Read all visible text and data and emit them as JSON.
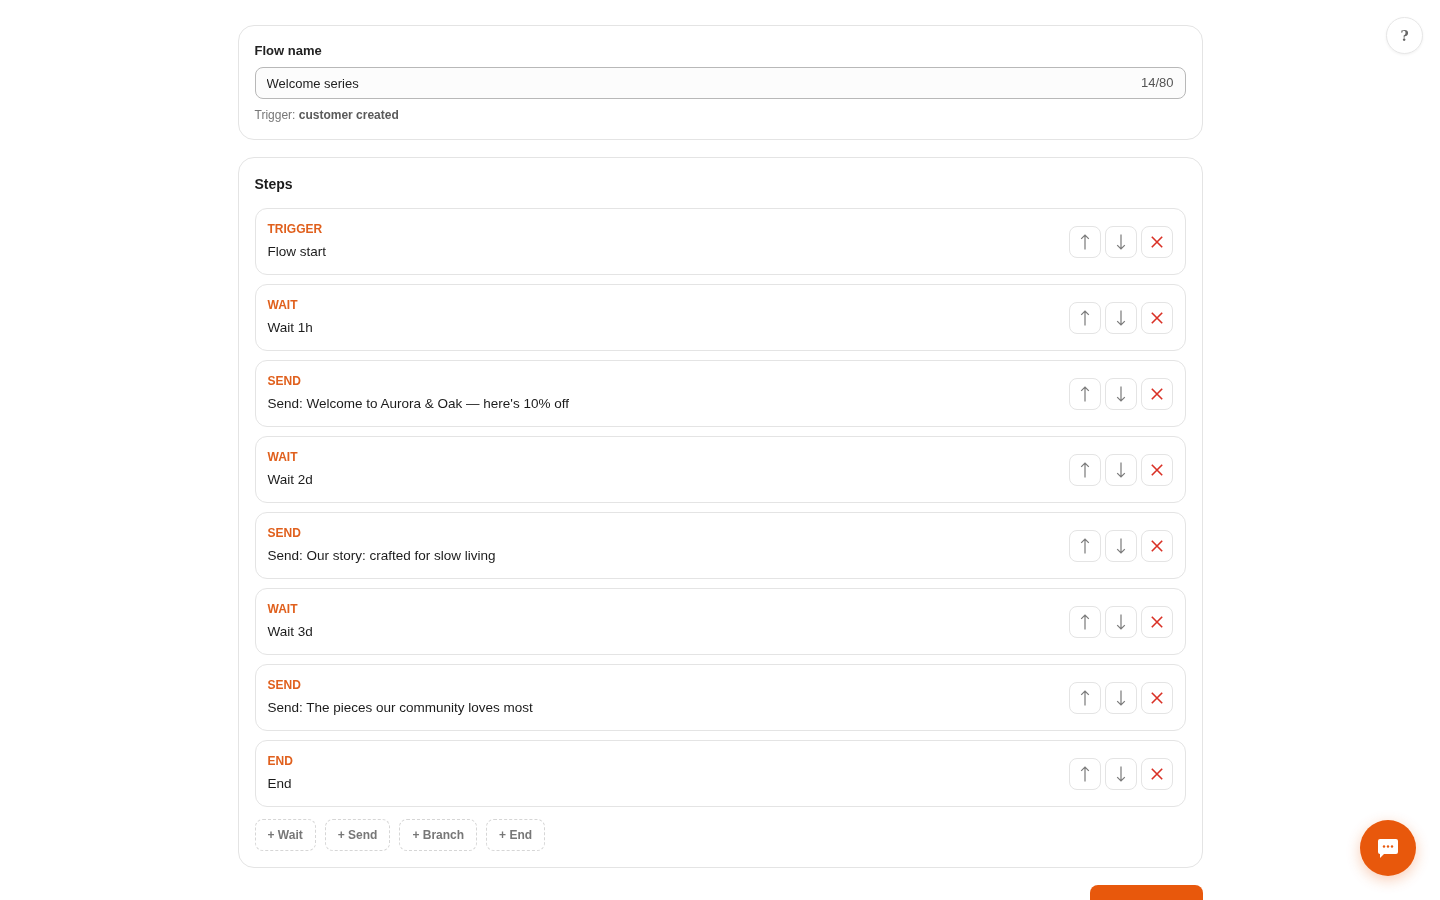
{
  "flow_name": {
    "label": "Flow name",
    "value": "Welcome series",
    "counter": "14/80",
    "note": "Trigger: **customer created**"
  },
  "steps": {
    "title": "Steps",
    "items": [
      {
        "type": "TRIGGER",
        "title": "Flow start"
      },
      {
        "type": "WAIT",
        "title": "Wait 1h"
      },
      {
        "type": "SEND",
        "title": "Send: Welcome to Aurora & Oak — here's 10% off"
      },
      {
        "type": "WAIT",
        "title": "Wait 2d"
      },
      {
        "type": "SEND",
        "title": "Send: Our story: crafted for slow living"
      },
      {
        "type": "WAIT",
        "title": "Wait 3d"
      },
      {
        "type": "SEND",
        "title": "Send: The pieces our community loves most"
      },
      {
        "type": "END",
        "title": "End"
      }
    ],
    "add_buttons": [
      "+ Wait",
      "+ Send",
      "+ Branch",
      "+ End"
    ]
  },
  "help_button": {
    "label": "?"
  }
}
